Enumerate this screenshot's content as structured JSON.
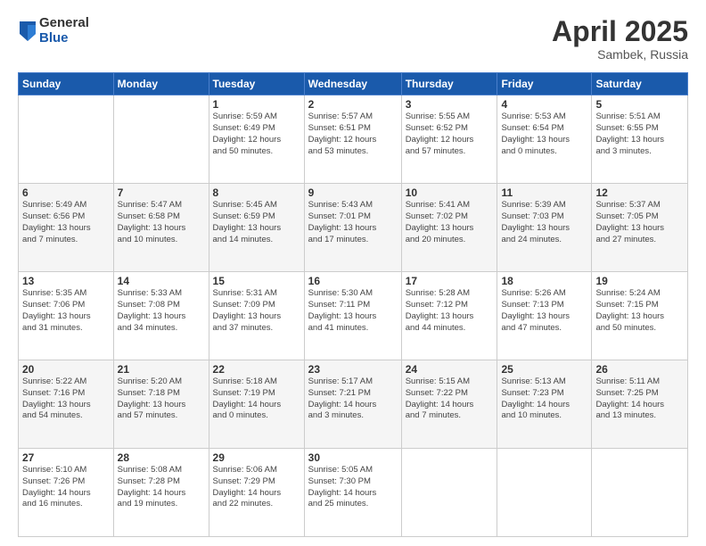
{
  "header": {
    "logo_general": "General",
    "logo_blue": "Blue",
    "month": "April 2025",
    "location": "Sambek, Russia"
  },
  "weekdays": [
    "Sunday",
    "Monday",
    "Tuesday",
    "Wednesday",
    "Thursday",
    "Friday",
    "Saturday"
  ],
  "weeks": [
    [
      {
        "day": "",
        "info": ""
      },
      {
        "day": "",
        "info": ""
      },
      {
        "day": "1",
        "info": "Sunrise: 5:59 AM\nSunset: 6:49 PM\nDaylight: 12 hours\nand 50 minutes."
      },
      {
        "day": "2",
        "info": "Sunrise: 5:57 AM\nSunset: 6:51 PM\nDaylight: 12 hours\nand 53 minutes."
      },
      {
        "day": "3",
        "info": "Sunrise: 5:55 AM\nSunset: 6:52 PM\nDaylight: 12 hours\nand 57 minutes."
      },
      {
        "day": "4",
        "info": "Sunrise: 5:53 AM\nSunset: 6:54 PM\nDaylight: 13 hours\nand 0 minutes."
      },
      {
        "day": "5",
        "info": "Sunrise: 5:51 AM\nSunset: 6:55 PM\nDaylight: 13 hours\nand 3 minutes."
      }
    ],
    [
      {
        "day": "6",
        "info": "Sunrise: 5:49 AM\nSunset: 6:56 PM\nDaylight: 13 hours\nand 7 minutes."
      },
      {
        "day": "7",
        "info": "Sunrise: 5:47 AM\nSunset: 6:58 PM\nDaylight: 13 hours\nand 10 minutes."
      },
      {
        "day": "8",
        "info": "Sunrise: 5:45 AM\nSunset: 6:59 PM\nDaylight: 13 hours\nand 14 minutes."
      },
      {
        "day": "9",
        "info": "Sunrise: 5:43 AM\nSunset: 7:01 PM\nDaylight: 13 hours\nand 17 minutes."
      },
      {
        "day": "10",
        "info": "Sunrise: 5:41 AM\nSunset: 7:02 PM\nDaylight: 13 hours\nand 20 minutes."
      },
      {
        "day": "11",
        "info": "Sunrise: 5:39 AM\nSunset: 7:03 PM\nDaylight: 13 hours\nand 24 minutes."
      },
      {
        "day": "12",
        "info": "Sunrise: 5:37 AM\nSunset: 7:05 PM\nDaylight: 13 hours\nand 27 minutes."
      }
    ],
    [
      {
        "day": "13",
        "info": "Sunrise: 5:35 AM\nSunset: 7:06 PM\nDaylight: 13 hours\nand 31 minutes."
      },
      {
        "day": "14",
        "info": "Sunrise: 5:33 AM\nSunset: 7:08 PM\nDaylight: 13 hours\nand 34 minutes."
      },
      {
        "day": "15",
        "info": "Sunrise: 5:31 AM\nSunset: 7:09 PM\nDaylight: 13 hours\nand 37 minutes."
      },
      {
        "day": "16",
        "info": "Sunrise: 5:30 AM\nSunset: 7:11 PM\nDaylight: 13 hours\nand 41 minutes."
      },
      {
        "day": "17",
        "info": "Sunrise: 5:28 AM\nSunset: 7:12 PM\nDaylight: 13 hours\nand 44 minutes."
      },
      {
        "day": "18",
        "info": "Sunrise: 5:26 AM\nSunset: 7:13 PM\nDaylight: 13 hours\nand 47 minutes."
      },
      {
        "day": "19",
        "info": "Sunrise: 5:24 AM\nSunset: 7:15 PM\nDaylight: 13 hours\nand 50 minutes."
      }
    ],
    [
      {
        "day": "20",
        "info": "Sunrise: 5:22 AM\nSunset: 7:16 PM\nDaylight: 13 hours\nand 54 minutes."
      },
      {
        "day": "21",
        "info": "Sunrise: 5:20 AM\nSunset: 7:18 PM\nDaylight: 13 hours\nand 57 minutes."
      },
      {
        "day": "22",
        "info": "Sunrise: 5:18 AM\nSunset: 7:19 PM\nDaylight: 14 hours\nand 0 minutes."
      },
      {
        "day": "23",
        "info": "Sunrise: 5:17 AM\nSunset: 7:21 PM\nDaylight: 14 hours\nand 3 minutes."
      },
      {
        "day": "24",
        "info": "Sunrise: 5:15 AM\nSunset: 7:22 PM\nDaylight: 14 hours\nand 7 minutes."
      },
      {
        "day": "25",
        "info": "Sunrise: 5:13 AM\nSunset: 7:23 PM\nDaylight: 14 hours\nand 10 minutes."
      },
      {
        "day": "26",
        "info": "Sunrise: 5:11 AM\nSunset: 7:25 PM\nDaylight: 14 hours\nand 13 minutes."
      }
    ],
    [
      {
        "day": "27",
        "info": "Sunrise: 5:10 AM\nSunset: 7:26 PM\nDaylight: 14 hours\nand 16 minutes."
      },
      {
        "day": "28",
        "info": "Sunrise: 5:08 AM\nSunset: 7:28 PM\nDaylight: 14 hours\nand 19 minutes."
      },
      {
        "day": "29",
        "info": "Sunrise: 5:06 AM\nSunset: 7:29 PM\nDaylight: 14 hours\nand 22 minutes."
      },
      {
        "day": "30",
        "info": "Sunrise: 5:05 AM\nSunset: 7:30 PM\nDaylight: 14 hours\nand 25 minutes."
      },
      {
        "day": "",
        "info": ""
      },
      {
        "day": "",
        "info": ""
      },
      {
        "day": "",
        "info": ""
      }
    ]
  ]
}
